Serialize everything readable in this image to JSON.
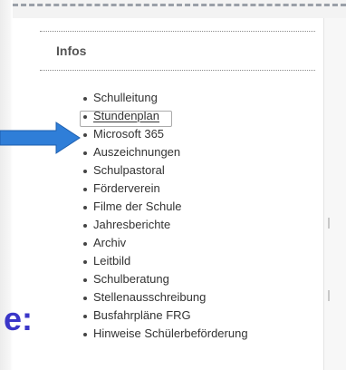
{
  "widget": {
    "title": "Infos",
    "items": [
      {
        "label": "Schulleitung",
        "active": false
      },
      {
        "label": "Stundenplan",
        "active": true
      },
      {
        "label": "Microsoft 365",
        "active": false
      },
      {
        "label": "Auszeichnungen",
        "active": false
      },
      {
        "label": "Schulpastoral",
        "active": false
      },
      {
        "label": "Förderverein",
        "active": false
      },
      {
        "label": "Filme der Schule",
        "active": false
      },
      {
        "label": "Jahresberichte",
        "active": false
      },
      {
        "label": "Archiv",
        "active": false
      },
      {
        "label": "Leitbild",
        "active": false
      },
      {
        "label": "Schulberatung",
        "active": false
      },
      {
        "label": "Stellenausschreibung",
        "active": false
      },
      {
        "label": "Busfahrpläne FRG",
        "active": false
      },
      {
        "label": "Hinweise Schülerbeförderung",
        "active": false
      }
    ]
  },
  "annotation": {
    "partial_text": "e:",
    "text_color": "#3a36c8",
    "arrow_color": "#2f7ed8"
  },
  "colors": {
    "title": "#555555",
    "link_text": "#333333",
    "divider": "#8c8c8c"
  }
}
